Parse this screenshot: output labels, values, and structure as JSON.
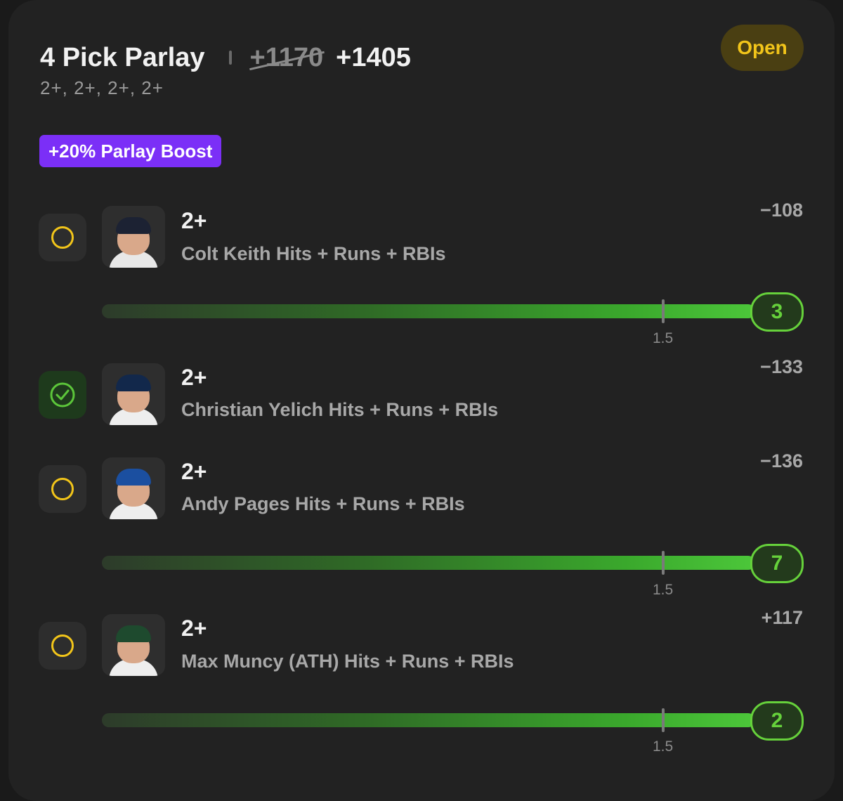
{
  "header": {
    "title": "4 Pick Parlay",
    "original_odds": "+1170",
    "boosted_odds": "+1405",
    "lines_summary": "2+, 2+, 2+, 2+",
    "status": "Open",
    "boost_badge": "+20% Parlay Boost"
  },
  "colors": {
    "accent_yellow": "#f2c51a",
    "boost_purple": "#7b2ff7",
    "progress_green": "#4cc73a"
  },
  "picks": [
    {
      "line": "2+",
      "market": "Colt Keith Hits + Runs + RBIs",
      "odds": "−108",
      "state": "open",
      "state_icon": "pending-circle-icon",
      "progress": {
        "threshold_label": "1.5",
        "result": "3"
      }
    },
    {
      "line": "2+",
      "market": "Christian Yelich Hits + Runs + RBIs",
      "odds": "−133",
      "state": "won",
      "state_icon": "check-circle-icon"
    },
    {
      "line": "2+",
      "market": "Andy Pages Hits + Runs + RBIs",
      "odds": "−136",
      "state": "open",
      "state_icon": "pending-circle-icon",
      "progress": {
        "threshold_label": "1.5",
        "result": "7"
      }
    },
    {
      "line": "2+",
      "market": "Max Muncy (ATH) Hits + Runs + RBIs",
      "odds": "+117",
      "state": "open",
      "state_icon": "pending-circle-icon",
      "progress": {
        "threshold_label": "1.5",
        "result": "2"
      }
    }
  ]
}
